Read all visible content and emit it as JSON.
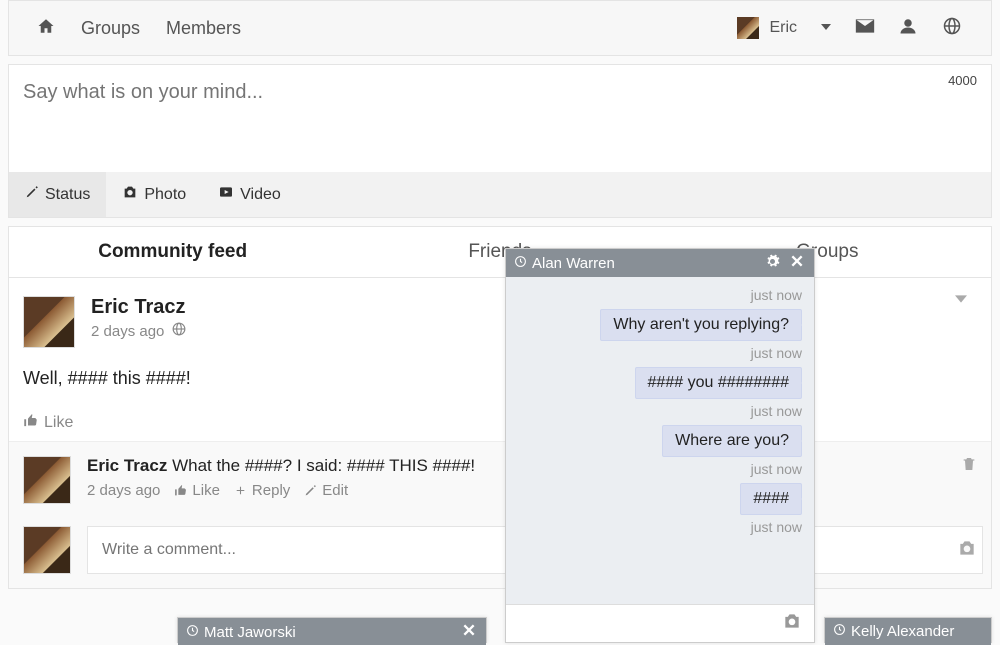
{
  "nav": {
    "groups": "Groups",
    "members": "Members",
    "username": "Eric"
  },
  "composer": {
    "placeholder": "Say what is on your mind...",
    "count": "4000",
    "tabs": {
      "status": "Status",
      "photo": "Photo",
      "video": "Video"
    }
  },
  "feed_tabs": {
    "community": "Community feed",
    "friends": "Friends",
    "groups": "Groups"
  },
  "post": {
    "author": "Eric Tracz",
    "time": "2 days ago",
    "body": "Well, #### this ####!",
    "like": "Like"
  },
  "comment": {
    "author": "Eric Tracz",
    "text": "What the ####? I said: #### THIS ####!",
    "time": "2 days ago",
    "like": "Like",
    "reply": "Reply",
    "edit": "Edit"
  },
  "write_comment_placeholder": "Write a comment...",
  "chat_alan": {
    "name": "Alan Warren",
    "messages": [
      {
        "time": "just now",
        "text": "Why aren't you replying?"
      },
      {
        "time": "just now",
        "text": "#### you ########"
      },
      {
        "time": "just now",
        "text": "Where are you?"
      },
      {
        "time": "just now",
        "text": "####"
      }
    ]
  },
  "chat_matt": {
    "name": "Matt Jaworski"
  },
  "chat_kelly": {
    "name": "Kelly Alexander"
  }
}
